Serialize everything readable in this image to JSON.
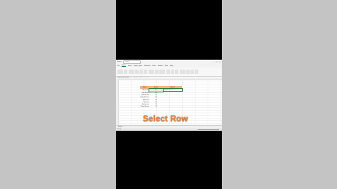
{
  "window": {
    "title": "Excel",
    "search_placeholder": "Search"
  },
  "menu": {
    "tabs": [
      "File",
      "Home",
      "Insert",
      "Page Layout",
      "Formulas",
      "Data",
      "Review",
      "View",
      "Help"
    ]
  },
  "formula_bar": {
    "name_box": "C3",
    "fx": "fx",
    "formula": "=IF(B3>=40,\"Pass\",\"Fail\")"
  },
  "table": {
    "headers": [
      "Name",
      "Score",
      "Result"
    ],
    "rows": [
      {
        "name": "Anil Kumar",
        "score": "45",
        "result": "=IF(B3>=40,\"Pass\")"
      },
      {
        "name": "Sahil Kumar",
        "score": "65",
        "result": ""
      },
      {
        "name": "Ankit Kumar",
        "score": "35",
        "result": ""
      },
      {
        "name": "Rahul Sharma",
        "score": "88",
        "result": ""
      },
      {
        "name": "Rohit Jain",
        "score": "90",
        "result": ""
      },
      {
        "name": "Ravi Jain",
        "score": "56",
        "result": ""
      },
      {
        "name": "Sachin Jain",
        "score": "39",
        "result": ""
      },
      {
        "name": "Manoj Kumar",
        "score": "70",
        "result": ""
      }
    ]
  },
  "sheet": {
    "tab": "Sheet1",
    "status": "Ready"
  },
  "caption": {
    "text": "Select Row"
  },
  "colors": {
    "header_fill": "#f4b183",
    "caption": "#f08a3b",
    "accent": "#1f7a3e"
  }
}
